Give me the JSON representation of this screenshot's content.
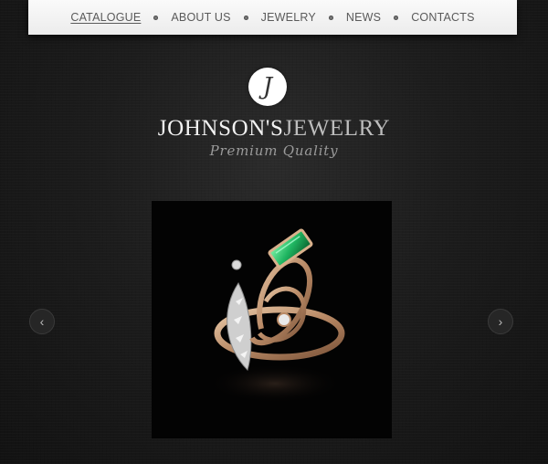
{
  "nav": {
    "items": [
      {
        "label": "CATALOGUE",
        "active": true
      },
      {
        "label": "ABOUT US",
        "active": false
      },
      {
        "label": "JEWELRY",
        "active": false
      },
      {
        "label": "NEWS",
        "active": false
      },
      {
        "label": "CONTACTS",
        "active": false
      }
    ]
  },
  "logo": {
    "letter": "J"
  },
  "brand": {
    "name_part1": "JOHNSON'S",
    "name_part2": "JEWELRY",
    "tagline": "Premium Quality"
  },
  "slider": {
    "prev_icon": "chevron-left-icon",
    "next_icon": "chevron-right-icon",
    "prev_glyph": "‹",
    "next_glyph": "›",
    "image": "ring-with-emerald"
  }
}
